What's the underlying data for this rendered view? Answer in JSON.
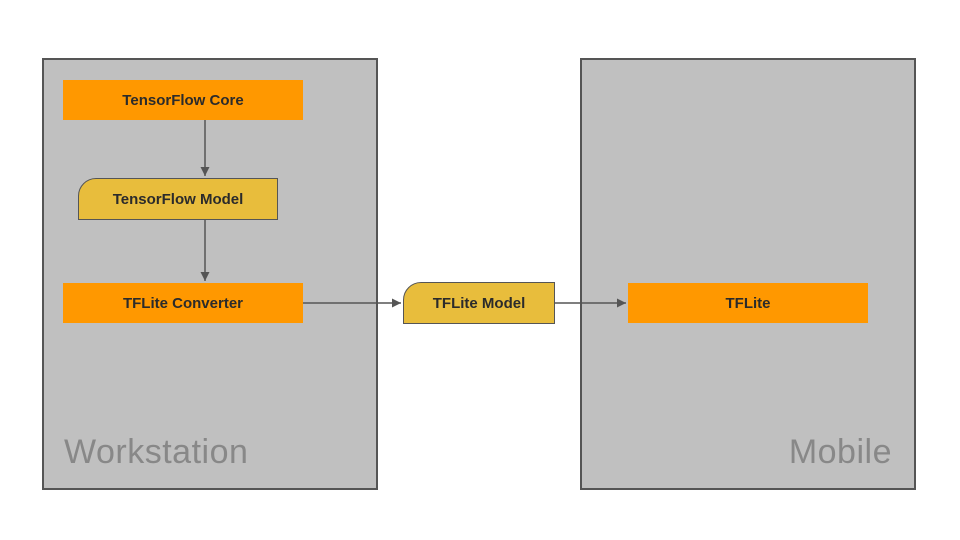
{
  "chart_data": {
    "type": "diagram",
    "title": "",
    "groups": [
      {
        "id": "workstation",
        "label": "Workstation"
      },
      {
        "id": "mobile",
        "label": "Mobile"
      }
    ],
    "nodes": [
      {
        "id": "tf_core",
        "label": "TensorFlow Core",
        "group": "workstation",
        "shape": "rect",
        "color": "#ff9800"
      },
      {
        "id": "tf_model",
        "label": "TensorFlow Model",
        "group": "workstation",
        "shape": "rounded",
        "color": "#e8bd3c"
      },
      {
        "id": "tflite_converter",
        "label": "TFLite Converter",
        "group": "workstation",
        "shape": "rect",
        "color": "#ff9800"
      },
      {
        "id": "tflite_model",
        "label": "TFLite Model",
        "group": null,
        "shape": "rounded",
        "color": "#e8bd3c"
      },
      {
        "id": "tflite",
        "label": "TFLite",
        "group": "mobile",
        "shape": "rect",
        "color": "#ff9800"
      }
    ],
    "edges": [
      {
        "from": "tf_core",
        "to": "tf_model"
      },
      {
        "from": "tf_model",
        "to": "tflite_converter"
      },
      {
        "from": "tflite_converter",
        "to": "tflite_model"
      },
      {
        "from": "tflite_model",
        "to": "tflite"
      }
    ]
  }
}
